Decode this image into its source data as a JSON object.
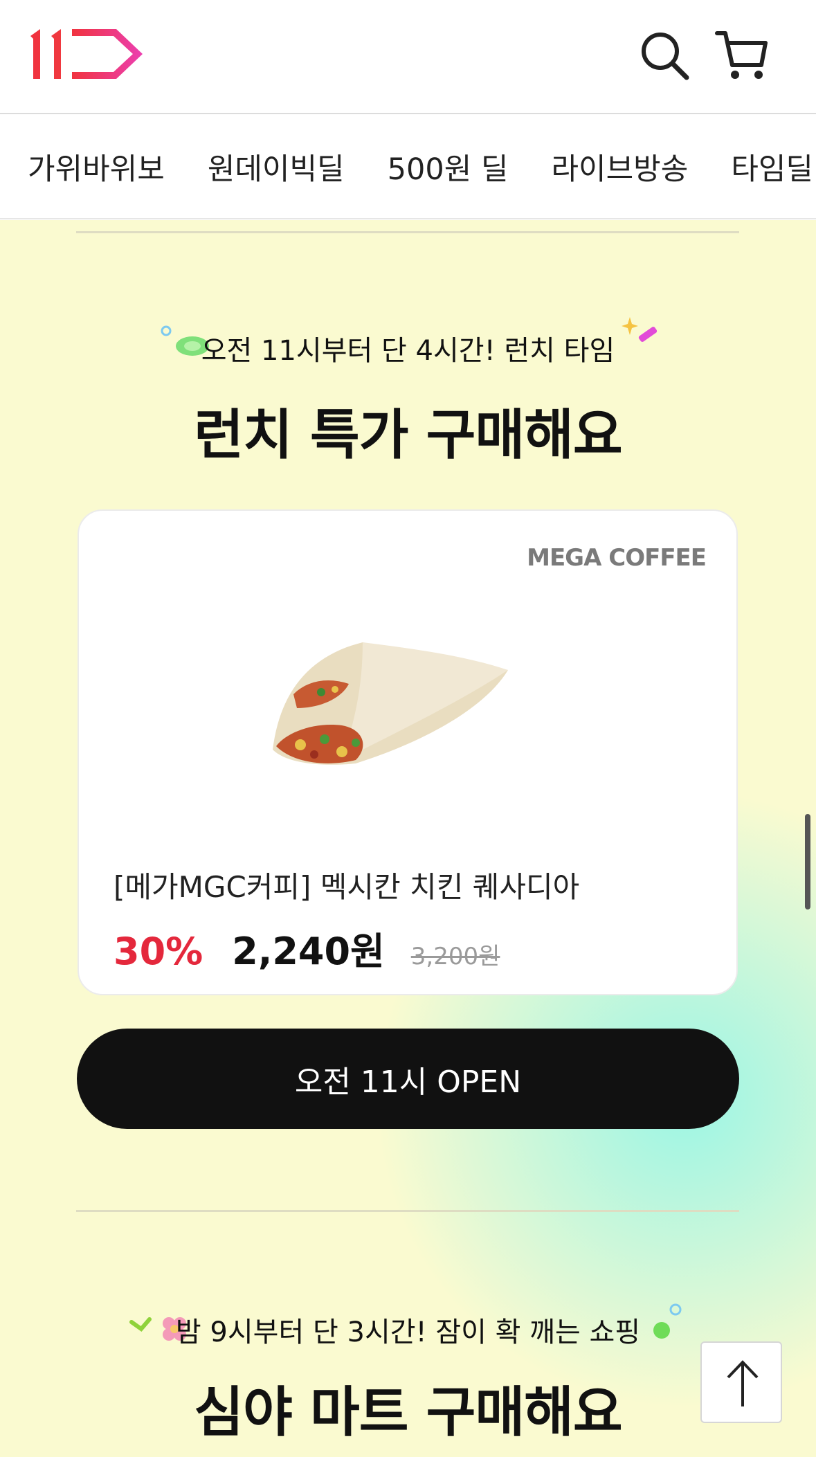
{
  "header": {
    "logo_text": "11",
    "search_icon": "search-icon",
    "cart_icon": "cart-icon"
  },
  "nav": {
    "items": [
      "가위바위보",
      "원데이빅딜",
      "500원 딜",
      "라이브방송",
      "타임딜"
    ]
  },
  "lunch_section": {
    "subtitle": "오전 11시부터 단 4시간! 런치 타임",
    "title": "런치 특가 구매해요",
    "product": {
      "brand": "MEGA COFFEE",
      "name": "[메가MGC커피] 멕시칸 치킨 퀘사디아",
      "discount": "30%",
      "price": "2,240원",
      "original_price": "3,200원"
    },
    "button_label": "오전 11시 OPEN"
  },
  "night_section": {
    "subtitle": "밤 9시부터 단 3시간! 잠이 확 깨는 쇼핑",
    "title": "심야 마트 구매해요"
  },
  "colors": {
    "accent": "#e4283c",
    "section_bg": "#fafad0",
    "button_bg": "#111111"
  }
}
